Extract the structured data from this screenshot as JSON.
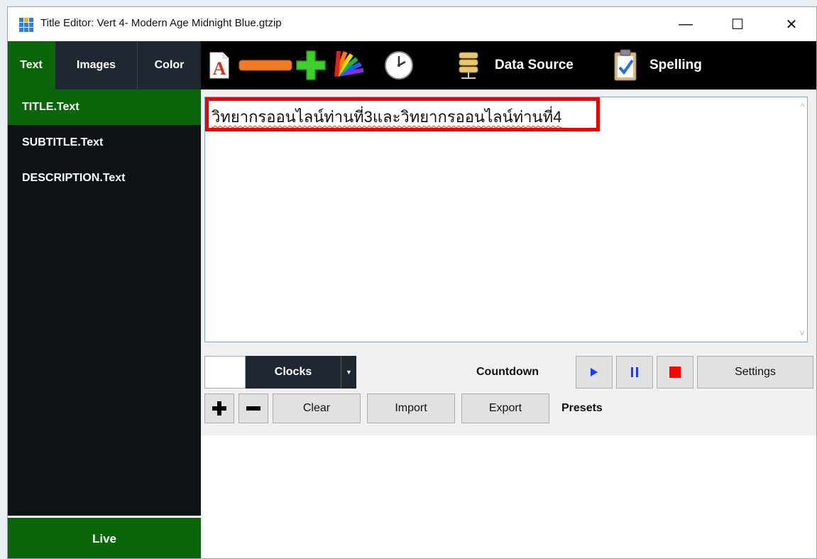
{
  "window": {
    "title": "Title Editor: Vert 4- Modern Age Midnight Blue.gtzip",
    "controls": {
      "minimize": "—",
      "maximize": "☐",
      "close": "✕"
    }
  },
  "tabs": [
    {
      "label": "Text",
      "active": true
    },
    {
      "label": "Images",
      "active": false
    },
    {
      "label": "Color",
      "active": false
    }
  ],
  "tree": [
    {
      "label": "TITLE.Text",
      "active": true
    },
    {
      "label": "SUBTITLE.Text",
      "active": false
    },
    {
      "label": "DESCRIPTION.Text",
      "active": false
    }
  ],
  "live_label": "Live",
  "toolbar": {
    "icons": [
      "font-icon",
      "remove-icon",
      "add-icon",
      "color-fan-icon",
      "clock-icon",
      "database-icon",
      "clipboard-check-icon"
    ],
    "data_source_label": "Data Source",
    "spelling_label": "Spelling"
  },
  "editor": {
    "text": "วิทยากรออนไลน์ท่านที่3และวิทยากรออนไลน์ท่านที่4"
  },
  "controls": {
    "clocks_label": "Clocks",
    "countdown_label": "Countdown",
    "settings_label": "Settings",
    "clear_label": "Clear",
    "import_label": "Import",
    "export_label": "Export",
    "presets_label": "Presets",
    "play_color": "#1a3cff",
    "pause_color": "#1a3cff",
    "stop_color": "#ff0000"
  },
  "colors": {
    "active_green": "#0b650b",
    "sidebar_dark": "#0d1217",
    "toolbar_black": "#000000",
    "highlight_red": "#ee0000"
  }
}
